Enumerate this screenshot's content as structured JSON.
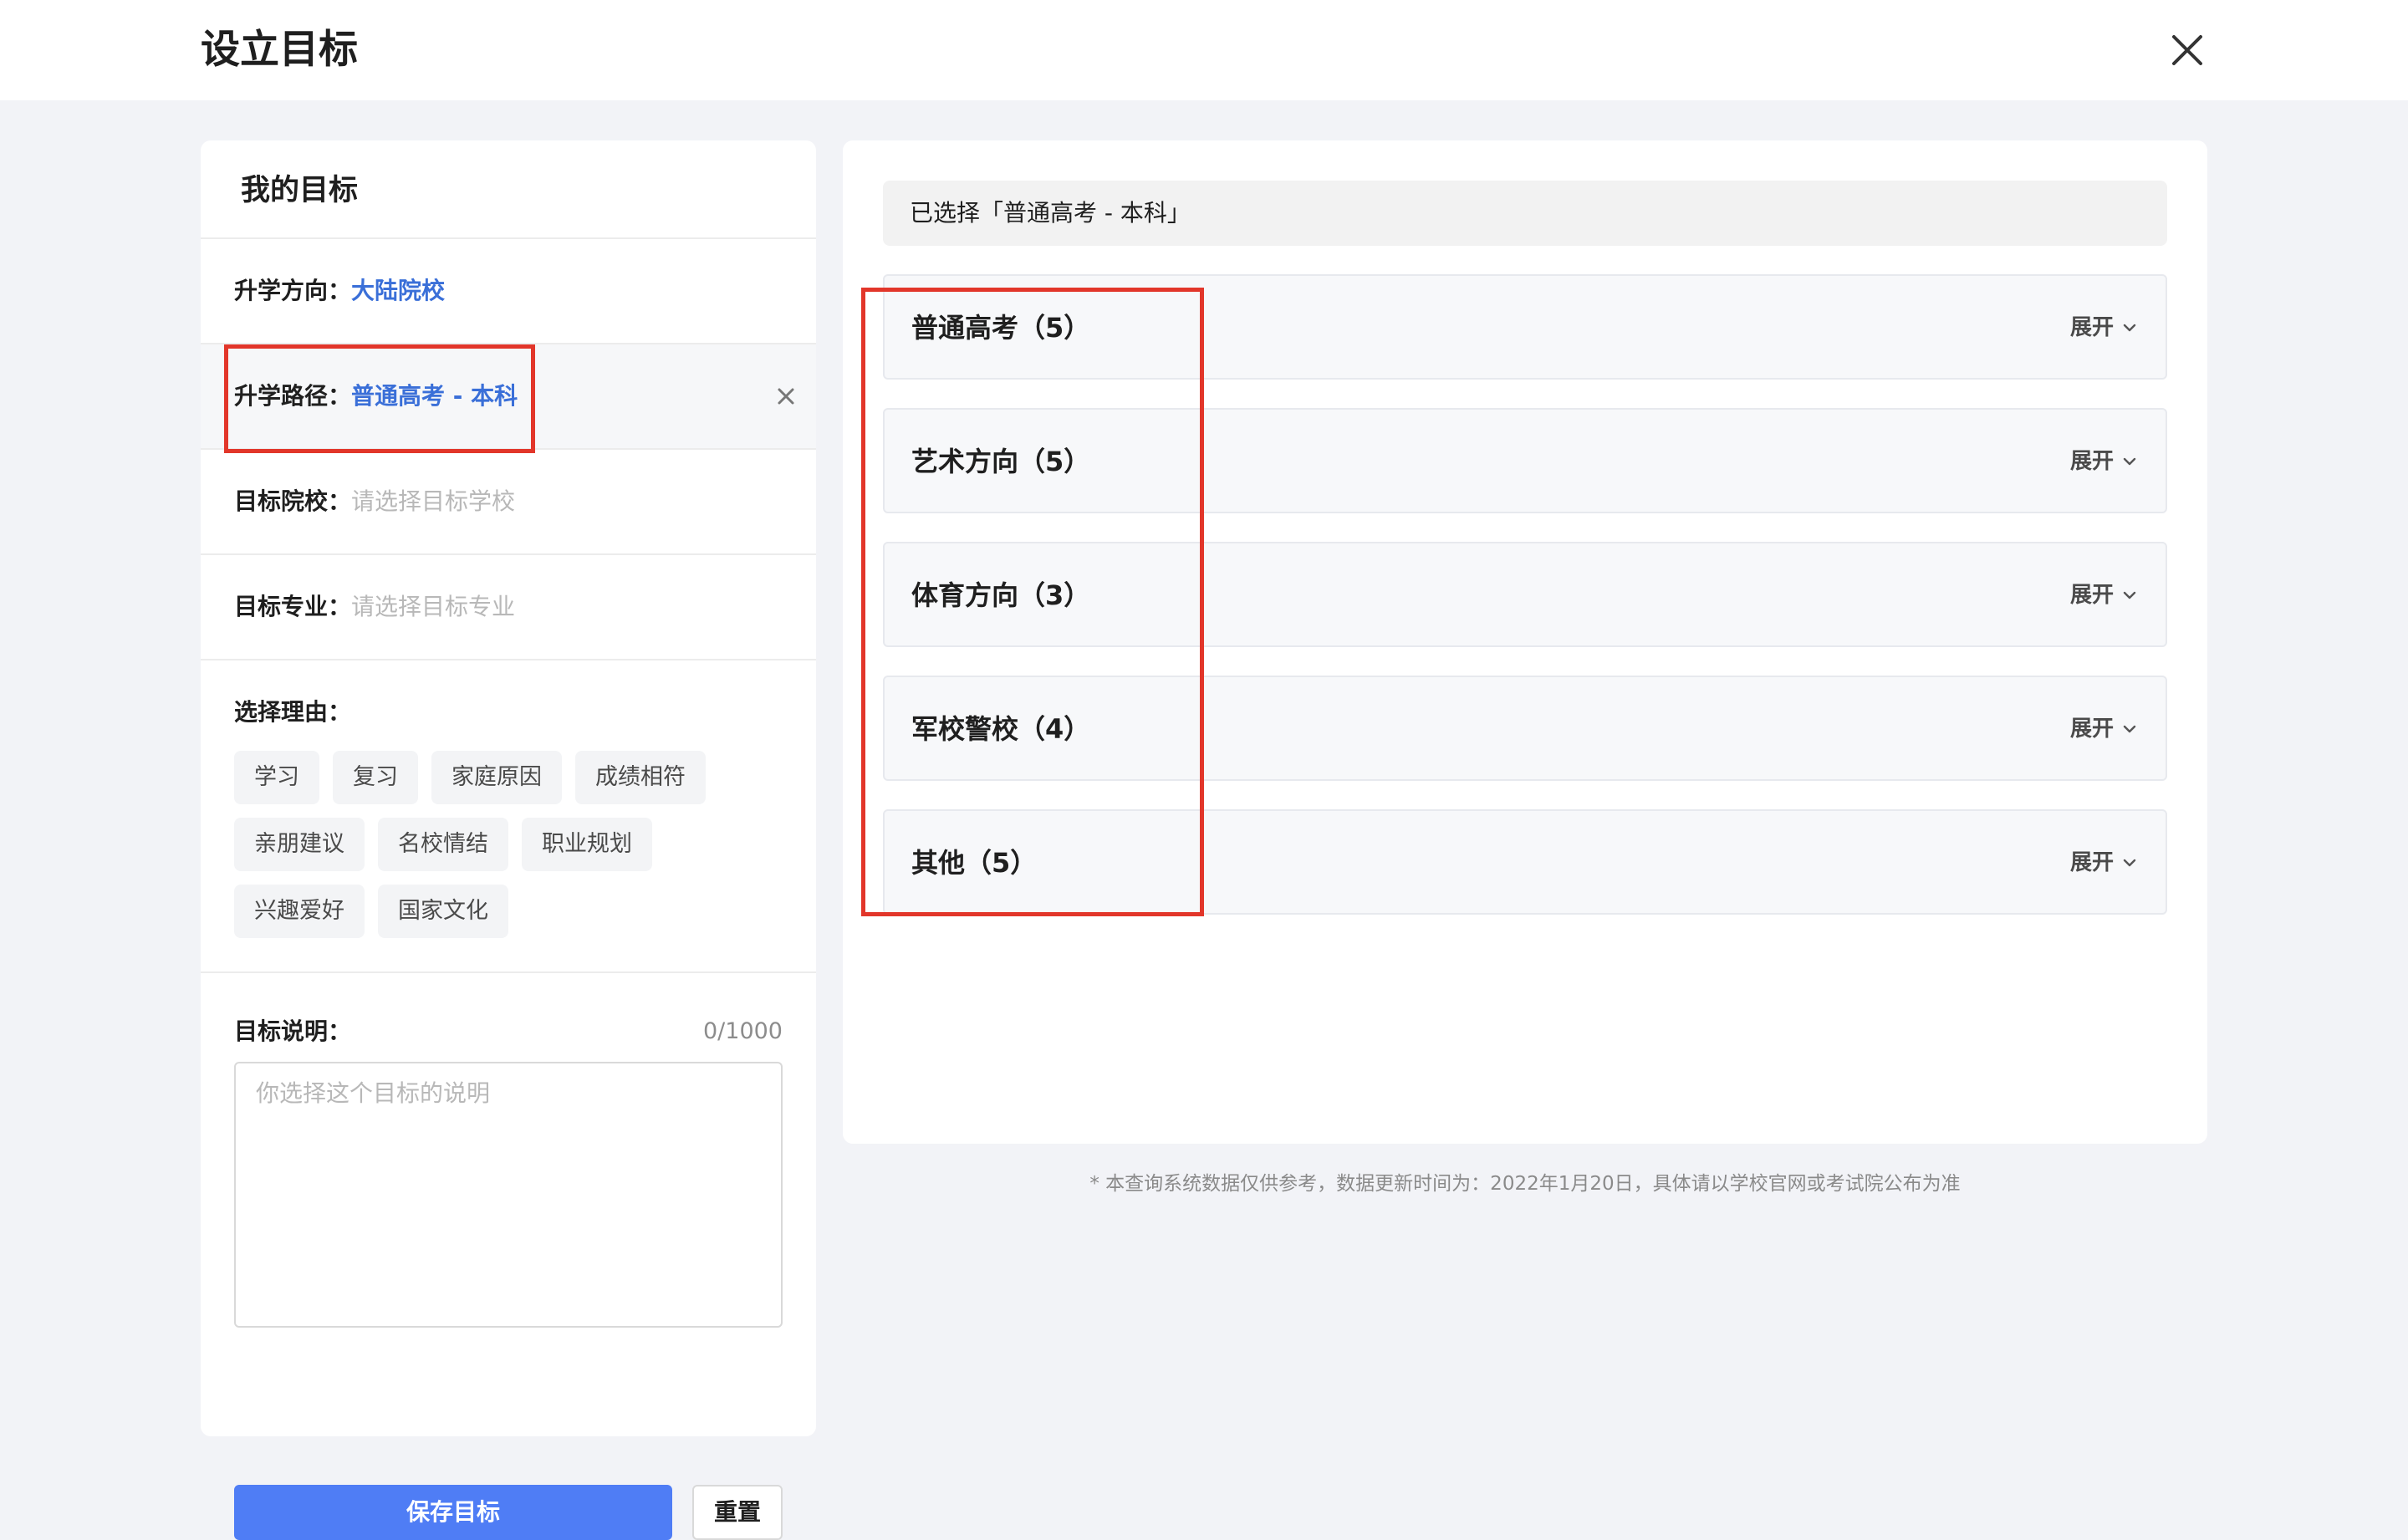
{
  "header": {
    "title": "设立目标",
    "close_icon": "close-icon"
  },
  "left_panel": {
    "title": "我的目标",
    "direction": {
      "label": "升学方向：",
      "value": "大陆院校"
    },
    "path": {
      "label": "升学路径：",
      "value": "普通高考 - 本科",
      "clear_icon": "close-icon"
    },
    "school": {
      "label": "目标院校：",
      "placeholder": "请选择目标学校"
    },
    "major": {
      "label": "目标专业：",
      "placeholder": "请选择目标专业"
    },
    "reasons": {
      "label": "选择理由：",
      "tags": [
        "学习",
        "复习",
        "家庭原因",
        "成绩相符",
        "亲朋建议",
        "名校情结",
        "职业规划",
        "兴趣爱好",
        "国家文化"
      ]
    },
    "description": {
      "label": "目标说明：",
      "counter": "0/1000",
      "placeholder": "你选择这个目标的说明",
      "value": ""
    },
    "save_label": "保存目标",
    "reset_label": "重置"
  },
  "right_panel": {
    "selected_text": "已选择「普通高考 - 本科」",
    "categories": [
      {
        "name": "普通高考（5）",
        "expand_label": "展开"
      },
      {
        "name": "艺术方向（5）",
        "expand_label": "展开"
      },
      {
        "name": "体育方向（3）",
        "expand_label": "展开"
      },
      {
        "name": "军校警校（4）",
        "expand_label": "展开"
      },
      {
        "name": "其他（5）",
        "expand_label": "展开"
      }
    ]
  },
  "footnote": "* 本查询系统数据仅供参考，数据更新时间为：2022年1月20日，具体请以学校官网或考试院公布为准",
  "colors": {
    "accent": "#3a6fd8",
    "primary_button": "#4f7df5",
    "highlight": "#e2362a",
    "background": "#f2f3f7"
  }
}
